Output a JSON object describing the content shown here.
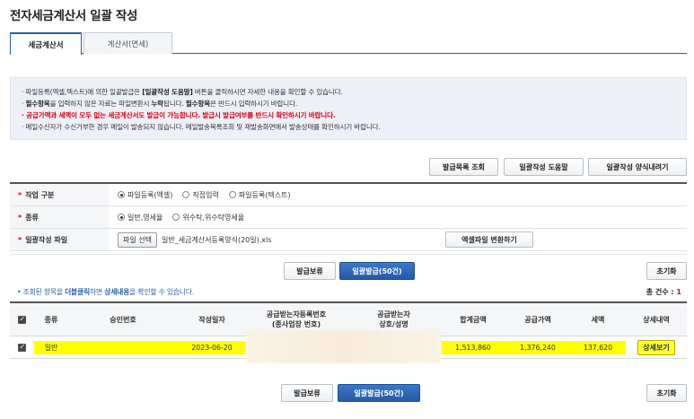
{
  "page": {
    "title": "전자세금계산서 일괄 작성"
  },
  "tabs": [
    {
      "label": "세금계산서"
    },
    {
      "label": "계산서(면세)"
    }
  ],
  "notice": {
    "l1_pre": "· 파일등록(엑셀,텍스트)에 의한 일괄발급은 ",
    "l1_bold": "[일괄작성 도움말]",
    "l1_post": " 버튼을 클릭하시면 자세한 내용을 확인할 수 있습니다.",
    "l2_pre": "· ",
    "l2_bold1": "필수항목",
    "l2_mid": "을 입력하지 않은 자료는 파일변환시 ",
    "l2_bold2": "누락",
    "l2_mid2": "됩니다. ",
    "l2_bold3": "필수항목",
    "l2_post": "은 반드시 입력하시기 바랍니다.",
    "l3": "· 공급가액과 세액이 모두 없는 세금계산서도 발급이 가능합니다. 발급시 발급여부를 반드시 확인하시기 바랍니다.",
    "l4": "· 메일수신자가 수신거부한 경우 메일이 발송되지 않습니다. 메일발송목록조회 및 재발송화면에서 발송상태를 확인하시기 바랍니다."
  },
  "top_buttons": {
    "list_query": "발급목록 조회",
    "help": "일괄작성 도움말",
    "download_form": "일괄작성 양식내려기"
  },
  "form": {
    "work_type": {
      "label": "작업 구분",
      "options": [
        "파일등록(엑셀)",
        "직접입력",
        "파일등록(텍스트)"
      ],
      "selected": "파일등록(엑셀)"
    },
    "kind": {
      "label": "종류",
      "options": [
        "일반,영세율",
        "위수탁,위수탁영세율"
      ],
      "selected": "일반,영세율"
    },
    "file": {
      "label": "일괄작성 파일",
      "choose_label": "파일 선택",
      "file_name": "일반_세금계산서등록양식(20일).xls",
      "convert_label": "엑셀파일 변환하기"
    }
  },
  "actions": {
    "hold": "발급보류",
    "issue": "일괄발급(50건)",
    "reset": "초기화"
  },
  "hint": {
    "pre": "• 조회된 항목을 ",
    "bold1": "더블클릭",
    "mid": "하면 ",
    "bold2": "상세내용",
    "post": "을 확인할 수 있습니다."
  },
  "total": {
    "label": "총 건수 :",
    "value": "1"
  },
  "grid": {
    "headers": {
      "kind": "종류",
      "approval_no": "승인번호",
      "date": "작성일자",
      "buyer_reg_1": "공급받는자등록번호",
      "buyer_reg_2": "(종사업장 번호)",
      "buyer_name_1": "공급받는자",
      "buyer_name_2": "상호/성명",
      "total_amount": "합계금액",
      "supply_amount": "공급가액",
      "tax": "세액",
      "detail": "상세내역"
    },
    "rows": [
      {
        "kind": "일반",
        "approval_no": "",
        "date": "2023-06-20",
        "total_amount": "1,513,860",
        "supply_amount": "1,376,240",
        "tax": "137,620",
        "detail_label": "상세보기"
      }
    ]
  },
  "colors": {
    "accent": "#2b5fa8",
    "alert": "#d6001c",
    "highlight": "#ffff00"
  }
}
